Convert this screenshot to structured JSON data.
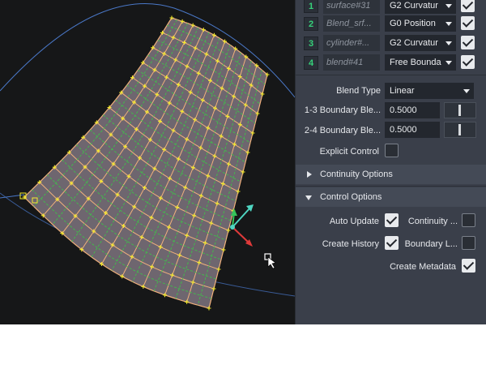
{
  "boundaries": [
    {
      "index": "1",
      "surface": "surface#31",
      "continuity": "G2 Curvatur",
      "checked": true
    },
    {
      "index": "2",
      "surface": "Blend_srf...",
      "continuity": "G0 Position",
      "checked": true
    },
    {
      "index": "3",
      "surface": "cylinder#...",
      "continuity": "G2 Curvatur",
      "checked": true
    },
    {
      "index": "4",
      "surface": "blend#41",
      "continuity": "Free Bounda",
      "checked": true
    }
  ],
  "blend_type": {
    "label": "Blend Type",
    "value": "Linear"
  },
  "boundary_13": {
    "label": "1-3 Boundary Ble...",
    "value": "0.5000"
  },
  "boundary_24": {
    "label": "2-4 Boundary Ble...",
    "value": "0.5000"
  },
  "explicit_control": {
    "label": "Explicit Control",
    "checked": false
  },
  "continuity_options": {
    "title": "Continuity Options",
    "expanded": false
  },
  "control_options": {
    "title": "Control Options",
    "expanded": true,
    "auto_update": {
      "label": "Auto Update",
      "checked": true
    },
    "continuity": {
      "label": "Continuity ...",
      "checked": false
    },
    "create_history": {
      "label": "Create History",
      "checked": true
    },
    "boundary_l": {
      "label": "Boundary L...",
      "checked": false
    },
    "create_metadata": {
      "label": "Create Metadata",
      "checked": true
    }
  },
  "colors": {
    "viewport_bg": "#161718",
    "surface_fill": "#6e666f",
    "iso_orange": "#f0b07c",
    "iso_green": "#3fbf4a",
    "cv_yellow": "#f4ec2c",
    "panel_bg": "#3a3f4a",
    "index_green": "#36d17a"
  }
}
